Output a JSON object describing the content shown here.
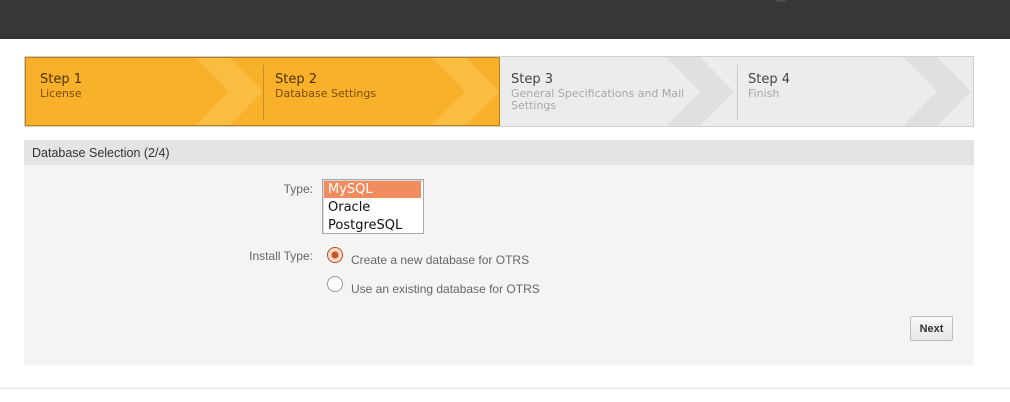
{
  "steps": [
    {
      "title": "Step 1",
      "subtitle": "License",
      "state": "done"
    },
    {
      "title": "Step 2",
      "subtitle": "Database Settings",
      "state": "current"
    },
    {
      "title": "Step 3",
      "subtitle": "General Specifications and Mail Settings",
      "state": "upcoming"
    },
    {
      "title": "Step 4",
      "subtitle": "Finish",
      "state": "upcoming"
    }
  ],
  "panel": {
    "title": "Database Selection (2/4)",
    "type_label": "Type:",
    "type_options": [
      "MySQL",
      "Oracle",
      "PostgreSQL"
    ],
    "type_selected": "MySQL",
    "install_type_label": "Install Type:",
    "install_options": [
      {
        "label": "Create a new database for OTRS",
        "checked": true
      },
      {
        "label": "Use an existing database for OTRS",
        "checked": false
      }
    ],
    "next_label": "Next"
  },
  "colors": {
    "accent": "#f9b12c",
    "selected_option": "#f28b5e",
    "radio_checked": "#c9541d",
    "topbar": "#373737"
  }
}
